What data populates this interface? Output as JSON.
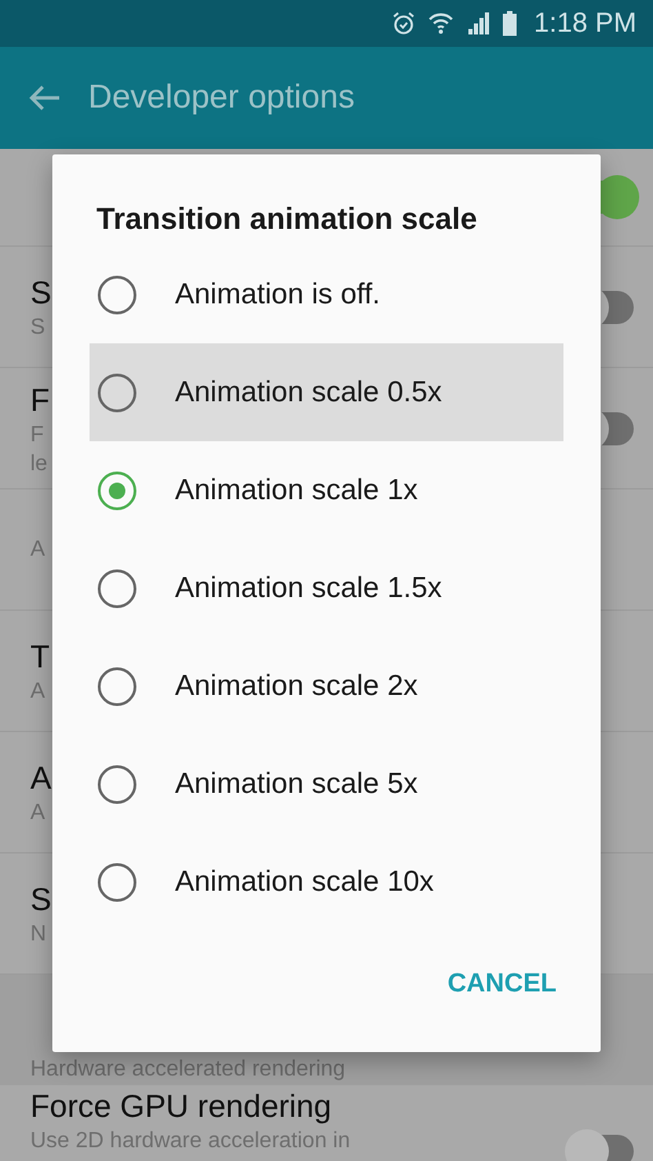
{
  "status_bar": {
    "time": "1:18 PM"
  },
  "toolbar": {
    "title": "Developer options"
  },
  "settings": [
    {
      "toggle": true
    },
    {
      "title": "S",
      "summary": [
        "S"
      ],
      "toggle": false
    },
    {
      "title": "F",
      "summary": [
        "F",
        "le"
      ],
      "toggle": false
    },
    {
      "summary": [
        "A"
      ]
    },
    {
      "title": "T",
      "summary": [
        "A"
      ]
    },
    {
      "title": "A",
      "summary": [
        "A"
      ]
    },
    {
      "title": "S",
      "summary": [
        "N"
      ]
    },
    {
      "kind": "header",
      "title": "Hardware accelerated rendering"
    },
    {
      "title": "Force GPU rendering",
      "summary": [
        "Use 2D hardware acceleration in"
      ],
      "toggle": false
    }
  ],
  "dialog": {
    "title": "Transition animation scale",
    "options": [
      {
        "label": "Animation is off.",
        "selected": false,
        "pressed": false
      },
      {
        "label": "Animation scale 0.5x",
        "selected": false,
        "pressed": true
      },
      {
        "label": "Animation scale 1x",
        "selected": true,
        "pressed": false
      },
      {
        "label": "Animation scale 1.5x",
        "selected": false,
        "pressed": false
      },
      {
        "label": "Animation scale 2x",
        "selected": false,
        "pressed": false
      },
      {
        "label": "Animation scale 5x",
        "selected": false,
        "pressed": false
      },
      {
        "label": "Animation scale 10x",
        "selected": false,
        "pressed": false
      }
    ],
    "button": "CANCEL"
  }
}
